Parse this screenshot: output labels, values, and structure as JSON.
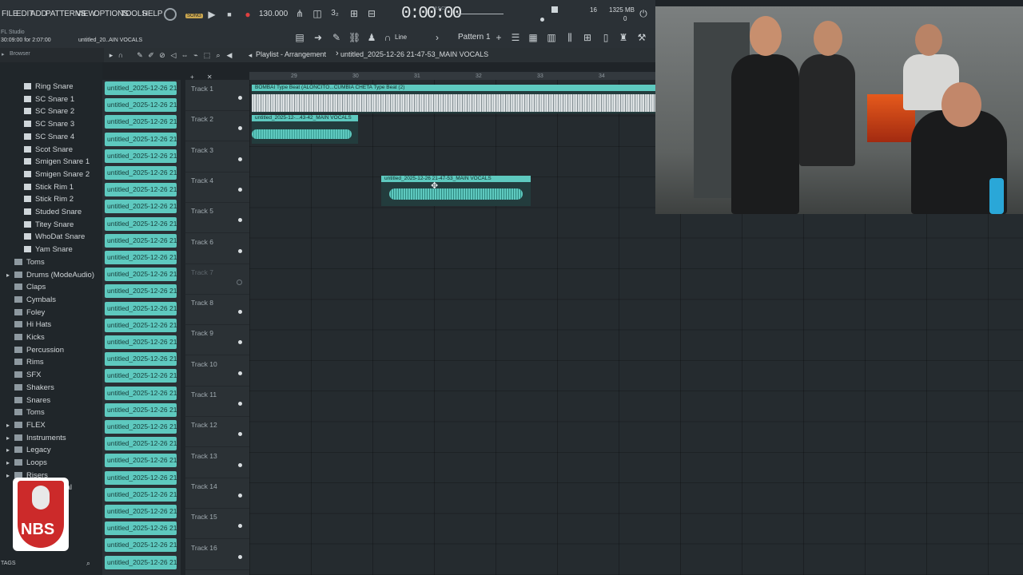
{
  "menu": [
    "FILE",
    "EDIT",
    "ADD",
    "PATTERNS",
    "VIEW",
    "OPTIONS",
    "TOOLS",
    "HELP"
  ],
  "song_mode": "SONG",
  "tempo": "130.000",
  "time": "0:00:00",
  "time_unit": "M:S:CS",
  "cpu_num": "16",
  "memory": "1325 MB",
  "memory_sub": "0",
  "app_name": "FL Studio",
  "hint_line": "30:09:00 for 2:07:00",
  "hint_file": "untitled_20..AIN VOCALS",
  "snap": "Line",
  "pattern": "Pattern 1",
  "browser_label": "Browser",
  "playlist_title": "Playlist - Arrangement",
  "playlist_file": "untitled_2025-12-26 21-47-53_MAIN VOCALS",
  "ruler": [
    "29",
    "30",
    "31",
    "32",
    "33",
    "34"
  ],
  "browser_items": [
    {
      "label": "Ring Snare",
      "type": "file"
    },
    {
      "label": "SC Snare 1",
      "type": "file"
    },
    {
      "label": "SC Snare 2",
      "type": "file"
    },
    {
      "label": "SC Snare 3",
      "type": "file"
    },
    {
      "label": "SC Snare 4",
      "type": "file"
    },
    {
      "label": "Scot Snare",
      "type": "file"
    },
    {
      "label": "Smigen Snare 1",
      "type": "file"
    },
    {
      "label": "Smigen Snare 2",
      "type": "file"
    },
    {
      "label": "Stick Rim 1",
      "type": "file"
    },
    {
      "label": "Stick Rim 2",
      "type": "file"
    },
    {
      "label": "Studed Snare",
      "type": "file"
    },
    {
      "label": "Titey Snare",
      "type": "file"
    },
    {
      "label": "WhoDat Snare",
      "type": "file"
    },
    {
      "label": "Yam Snare",
      "type": "file"
    },
    {
      "label": "Toms",
      "type": "folder"
    },
    {
      "label": "Drums (ModeAudio)",
      "type": "folder-open"
    },
    {
      "label": "Claps",
      "type": "folder"
    },
    {
      "label": "Cymbals",
      "type": "folder"
    },
    {
      "label": "Foley",
      "type": "folder"
    },
    {
      "label": "Hi Hats",
      "type": "folder"
    },
    {
      "label": "Kicks",
      "type": "folder"
    },
    {
      "label": "Percussion",
      "type": "folder"
    },
    {
      "label": "Rims",
      "type": "folder"
    },
    {
      "label": "SFX",
      "type": "folder"
    },
    {
      "label": "Shakers",
      "type": "folder"
    },
    {
      "label": "Snares",
      "type": "folder"
    },
    {
      "label": "Toms",
      "type": "folder"
    },
    {
      "label": "FLEX",
      "type": "folder-top"
    },
    {
      "label": "Instruments",
      "type": "folder-top"
    },
    {
      "label": "Legacy",
      "type": "folder-top"
    },
    {
      "label": "Loops",
      "type": "folder-top"
    },
    {
      "label": "Risers",
      "type": "folder-top"
    },
    {
      "label": "Riser Cymbal",
      "type": "folder"
    }
  ],
  "clip_label": "untitled_2025-12-26 21-",
  "tracks": [
    "Track 1",
    "Track 2",
    "Track 3",
    "Track 4",
    "Track 5",
    "Track 6",
    "Track 7",
    "Track 8",
    "Track 9",
    "Track 10",
    "Track 11",
    "Track 12",
    "Track 13",
    "Track 14",
    "Track 15",
    "Track 16"
  ],
  "clips": {
    "beat": "BOMBAI Type Beat (ALONCITO...CUMBIA CHETA Type Beat (2)",
    "vocal1": "untitled_2025-12-...43-42_MAIN VOCALS",
    "vocal2": "untitled_2025-12-26 21-47-53_MAIN VOCALS"
  },
  "tags_label": "TAGS",
  "logo_text": "NBS",
  "colors": {
    "accent": "#5ec9bf",
    "bg": "#1f2428"
  }
}
